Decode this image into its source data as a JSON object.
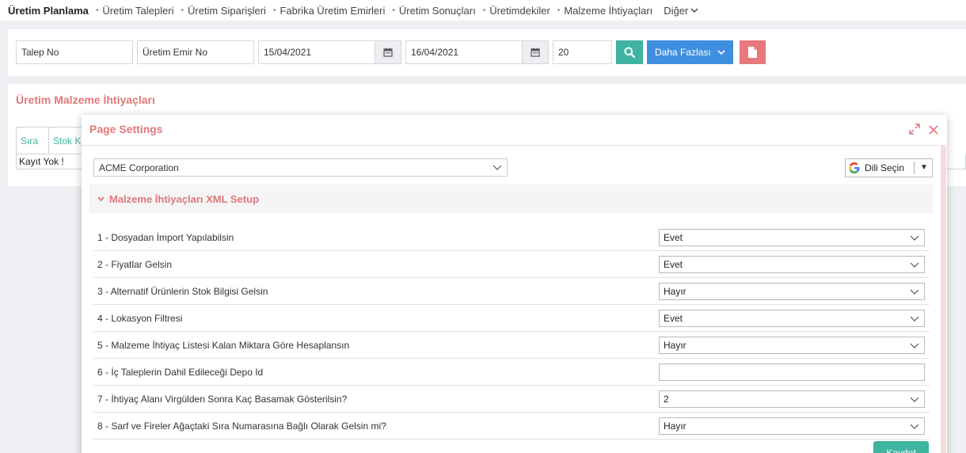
{
  "nav": {
    "brand": "Üretim Planlama",
    "items": [
      {
        "label": "Üretim Talepleri"
      },
      {
        "label": "Üretim Siparişleri"
      },
      {
        "label": "Fabrika Üretim Emirleri"
      },
      {
        "label": "Üretim Sonuçları"
      },
      {
        "label": "Üretimdekiler"
      },
      {
        "label": "Malzeme İhtiyaçları"
      }
    ],
    "more": "Diğer"
  },
  "filters": {
    "request_no": "Talep No",
    "order_no": "Üretim Emir No",
    "date_from": "15/04/2021",
    "date_to": "16/04/2021",
    "page_size": "20",
    "more_button": "Daha Fazlası"
  },
  "panel": {
    "title": "Üretim Malzeme İhtiyaçları",
    "columns": [
      "Sıra",
      "Stok Ko"
    ],
    "empty": "Kayıt Yok !"
  },
  "modal": {
    "title": "Page Settings",
    "company": "ACME Corporation",
    "language": "Dili Seçin",
    "section": "Malzeme İhtiyaçları XML Setup",
    "settings": [
      {
        "label": "1 - Dosyadan İmport Yapılabilsin",
        "value": "Evet"
      },
      {
        "label": "2 - Fiyatlar Gelsin",
        "value": "Evet"
      },
      {
        "label": "3 - Alternatif Ürünlerin Stok Bilgisi Gelsin",
        "value": "Hayır"
      },
      {
        "label": "4 - Lokasyon Filtresi",
        "value": "Evet"
      },
      {
        "label": "5 - Malzeme İhtiyaç Listesi Kalan Miktara Göre Hesaplansın",
        "value": "Hayır"
      },
      {
        "label": "6 - İç Taleplerin Dahil Edileceği Depo Id",
        "value": ""
      },
      {
        "label": "7 - İhtiyaç Alanı Virgülden Sonra Kaç Basamak Gösterilsin?",
        "value": "2"
      },
      {
        "label": "8 - Sarf ve Fireler Ağaçtaki Sıra Numarasına Bağlı Olarak Gelsin mi?",
        "value": "Hayır"
      }
    ],
    "save": "Kaydet"
  },
  "colors": {
    "teal": "#3fb4a0",
    "blue": "#3f8fe0",
    "salmon": "#e0797b"
  }
}
